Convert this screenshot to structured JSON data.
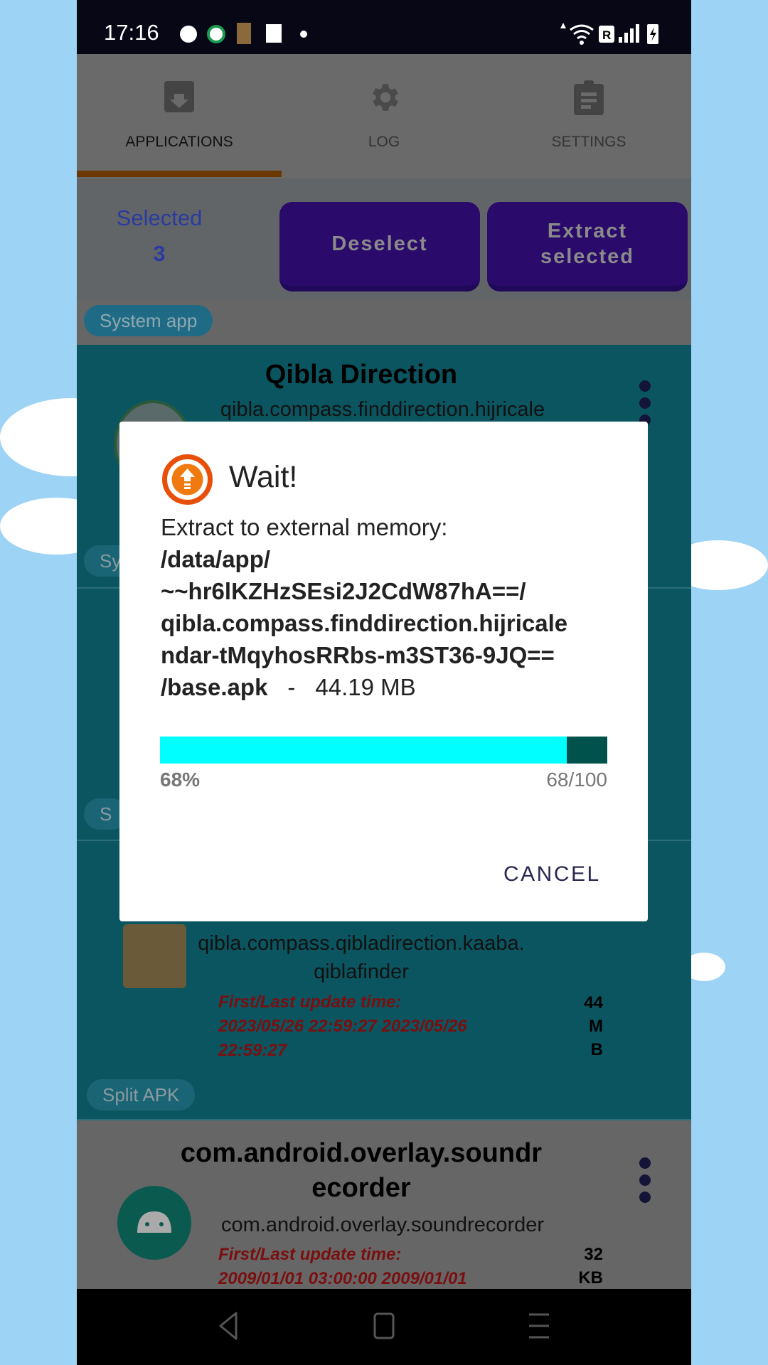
{
  "status_bar": {
    "time": "17:16",
    "icons": [
      "notification-app-icons",
      "dot-icon",
      "data-arrow-icon",
      "wifi-icon",
      "roaming-r-icon",
      "signal-icon",
      "battery-charging-icon"
    ]
  },
  "tabs": [
    {
      "label": "APPLICATIONS",
      "icon": "archive-download-icon",
      "active": true
    },
    {
      "label": "LOG",
      "icon": "gear-icon"
    },
    {
      "label": "SETTINGS",
      "icon": "clipboard-icon"
    }
  ],
  "selection": {
    "label": "Selected",
    "count": "3",
    "deselect": "Deselect",
    "extract": "Extract selected"
  },
  "apps": [
    {
      "chip": "System app",
      "title": "Qibla Direction",
      "package": "qibla.compass.finddirection.hijricale",
      "chip_below": "Sy"
    },
    {
      "chip_below": "S"
    },
    {
      "package_lines": [
        "qibla.compass.qibladirection.kaaba.",
        "qiblafinder"
      ],
      "dates_lines": [
        "First/Last update time:",
        "2023/05/26 22:59:27   2023/05/26",
        "22:59:27"
      ],
      "size_lines": [
        "44",
        "M",
        "B"
      ],
      "chip": "Split APK"
    },
    {
      "title_lines": [
        "com.android.overlay.soundr",
        "ecorder"
      ],
      "package": "com.android.overlay.soundrecorder",
      "dates_lines": [
        "First/Last update time:",
        "2009/01/01 03:00:00   2009/01/01"
      ],
      "size_lines": [
        "32",
        "KB"
      ]
    }
  ],
  "dialog": {
    "title": "Wait!",
    "message": "Extract to external memory:",
    "path_lines": [
      "/data/app/",
      "~~hr6lKZHzSEsi2J2CdW87hA==/",
      "qibla.compass.finddirection.hijricale",
      "ndar-tMqyhosRRbs-m3ST36-9JQ=="
    ],
    "last_path": "/base.apk",
    "separator": "-",
    "file_size": "44.19 MB",
    "progress_percent_label": "68%",
    "progress_count_label": "68/100",
    "progress_value": 68,
    "progress_max": 100,
    "bar_fill_percent": 91,
    "bar_color": "#00ffff",
    "track_color": "#00534d",
    "cancel": "CANCEL",
    "icon": "orange-upload-icon"
  },
  "colors": {
    "accent_indicator": "#6b3800",
    "button": "#2a0a6a",
    "selected_text": "#2a3aa0",
    "dates_text": "#7a0f10",
    "cancel_text": "#2a2850"
  }
}
